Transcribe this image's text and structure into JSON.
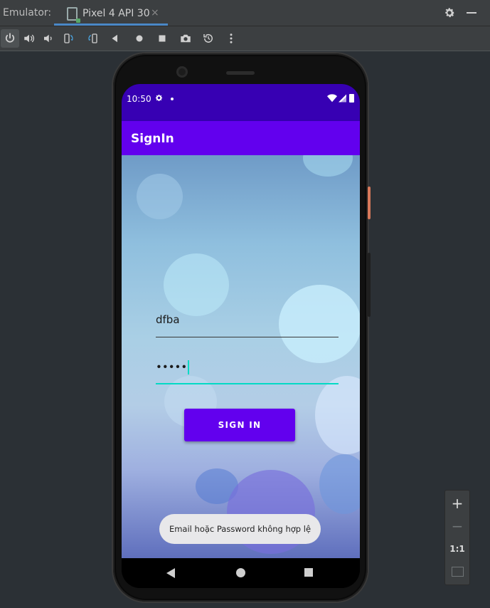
{
  "topbar": {
    "label": "Emulator:",
    "tab_title": "Pixel 4 API 30",
    "close_glyph": "×"
  },
  "toolbar": {
    "icons": [
      "power-icon",
      "volume-up-icon",
      "volume-down-icon",
      "rotate-left-icon",
      "rotate-right-icon",
      "back-icon",
      "home-icon",
      "overview-icon",
      "camera-icon",
      "snapshot-icon",
      "more-icon"
    ]
  },
  "device": {
    "status_bar": {
      "time": "10:50"
    },
    "app_bar": {
      "title": "SignIn"
    },
    "form": {
      "email_value": "dfba",
      "password_value": "•••••",
      "sign_in_label": "SIGN IN"
    },
    "toast": {
      "message": "Email hoặc Password không hợp lệ"
    },
    "colors": {
      "status_bar": "#3700b3",
      "primary": "#6200ee",
      "accent": "#03dac5"
    }
  },
  "zoom_panel": {
    "zoom_in": "+",
    "zoom_out": "−",
    "actual_size": "1:1"
  }
}
